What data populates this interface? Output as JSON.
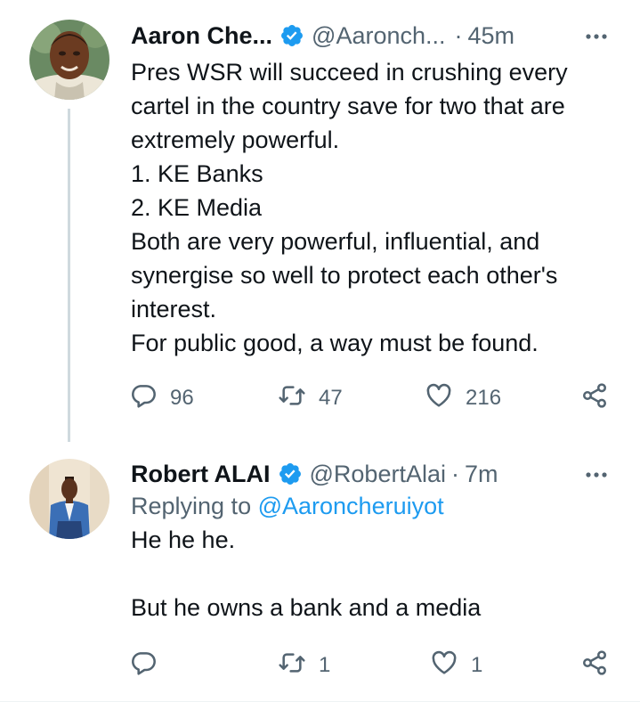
{
  "tweets": [
    {
      "author_name": "Aaron Che...",
      "handle": "@Aaronch...",
      "separator": "·",
      "time": "45m",
      "text_lines": [
        "Pres WSR will succeed in crushing every",
        "cartel in the country save for two that are",
        "extremely powerful.",
        "1. KE Banks",
        "2. KE Media",
        "Both are very powerful, influential, and",
        "synergise so well to protect each other's",
        "interest.",
        "For public good, a way must be found."
      ],
      "replies": "96",
      "retweets": "47",
      "likes": "216"
    },
    {
      "author_name": "Robert ALAI",
      "handle": "@RobertAlai",
      "separator": "·",
      "time": "7m",
      "replying_prefix": "Replying to ",
      "replying_to": "@Aaroncheruiyot",
      "text_lines": [
        "He he he.",
        "",
        "But he owns a bank and a media"
      ],
      "replies": "",
      "retweets": "1",
      "likes": "1"
    }
  ],
  "colors": {
    "text": "#0f1419",
    "secondary": "#536471",
    "accent": "#1d9bf0",
    "thread_line": "#cfd9de"
  },
  "icons": [
    "verified-badge-icon",
    "more-icon",
    "reply-icon",
    "retweet-icon",
    "like-icon",
    "share-icon"
  ]
}
